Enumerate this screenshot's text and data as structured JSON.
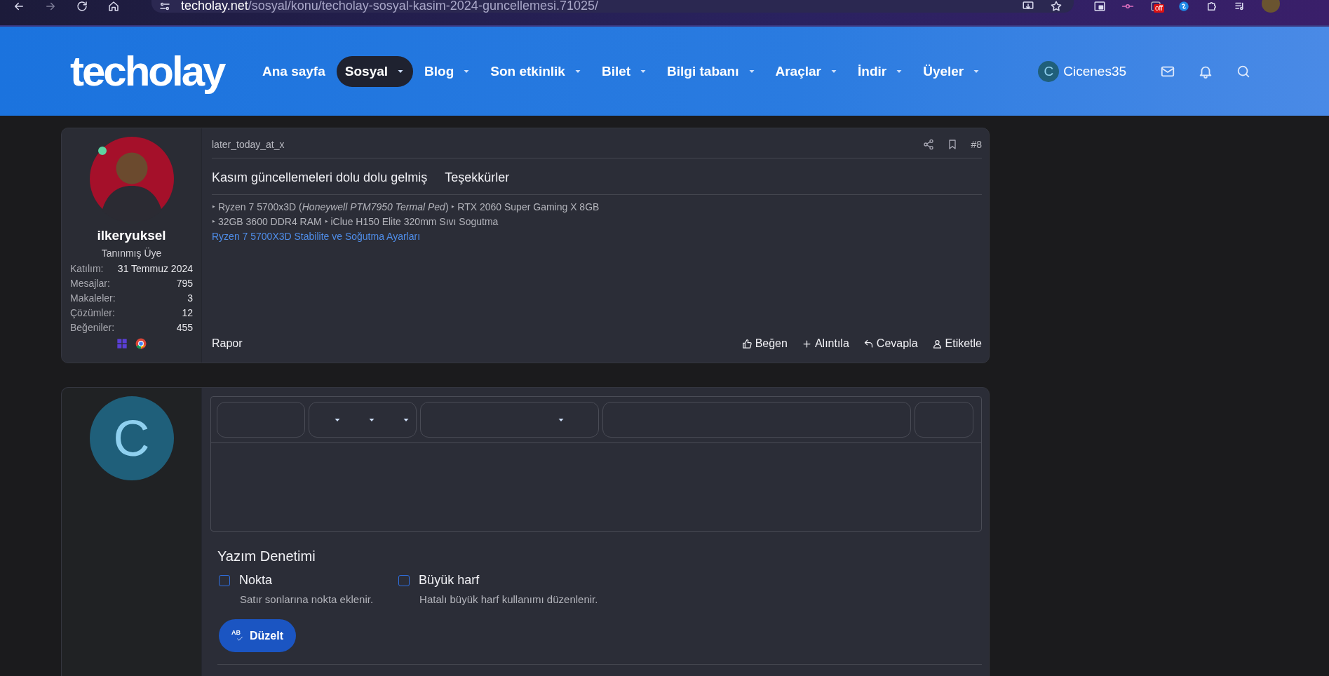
{
  "browser": {
    "url_host": "techolay.net",
    "url_path": "/sosyal/konu/techolay-sosyal-kasim-2024-guncellemesi.71025/",
    "extension_badge": "off"
  },
  "nav": {
    "logo": "techolay",
    "items": [
      {
        "label": "Ana sayfa",
        "has_menu": false,
        "selected": false
      },
      {
        "label": "Sosyal",
        "has_menu": true,
        "selected": true
      },
      {
        "label": "Blog",
        "has_menu": true,
        "selected": false
      },
      {
        "label": "Son etkinlik",
        "has_menu": true,
        "selected": false
      },
      {
        "label": "Bilet",
        "has_menu": true,
        "selected": false
      },
      {
        "label": "Bilgi tabanı",
        "has_menu": true,
        "selected": false
      },
      {
        "label": "Araçlar",
        "has_menu": true,
        "selected": false
      },
      {
        "label": "İndir",
        "has_menu": true,
        "selected": false
      },
      {
        "label": "Üyeler",
        "has_menu": true,
        "selected": false
      }
    ],
    "user": {
      "initial": "C",
      "name": "Cicenes35"
    }
  },
  "post": {
    "user": {
      "name": "ilkeryuksel",
      "title": "Tanınmış Üye",
      "online": true,
      "stats": [
        {
          "label": "Katılım:",
          "value": "31 Temmuz 2024"
        },
        {
          "label": "Mesajlar:",
          "value": "795"
        },
        {
          "label": "Makaleler:",
          "value": "3"
        },
        {
          "label": "Çözümler:",
          "value": "12"
        },
        {
          "label": "Beğeniler:",
          "value": "455"
        }
      ]
    },
    "meta": "later_today_at_x",
    "number": "#8",
    "body": [
      "Kasım güncellemeleri dolu dolu gelmiş",
      "Teşekkürler"
    ],
    "signature": [
      {
        "kind": "text",
        "text": "‣ Ryzen 7 5700x3D (*Honeywell PTM7950 Termal Ped*) ‣ RTX 2060 Super Gaming X 8GB"
      },
      {
        "kind": "text",
        "text": "‣ 32GB 3600 DDR4 RAM ‣ iClue H150 Elite 320mm Sıvı Sogutma"
      },
      {
        "kind": "link",
        "text": "Ryzen 7 5700X3D Stabilite ve Soğutma Ayarları"
      }
    ],
    "report": "Rapor",
    "actions": [
      {
        "kind": "like",
        "label": "Beğen"
      },
      {
        "kind": "quote",
        "label": "Alıntıla"
      },
      {
        "kind": "reply",
        "label": "Cevapla"
      },
      {
        "kind": "tag",
        "label": "Etiketle"
      }
    ]
  },
  "editor": {
    "avatar_initial": "C",
    "toolbar": [
      {
        "kind": "empty"
      },
      {
        "kind": "triple-dropdown"
      },
      {
        "kind": "dropdown"
      },
      {
        "kind": "empty"
      },
      {
        "kind": "empty"
      }
    ],
    "spellcheck": {
      "title": "Yazım Denetimi",
      "options": [
        {
          "label": "Nokta",
          "hint": "Satır sonlarına nokta eklenir.",
          "checked": false
        },
        {
          "label": "Büyük harf",
          "hint": "Hatalı büyük harf kullanımı düzenlenir.",
          "checked": false
        }
      ],
      "button": {
        "icon_text": "AB",
        "label": "Düzelt"
      }
    }
  }
}
